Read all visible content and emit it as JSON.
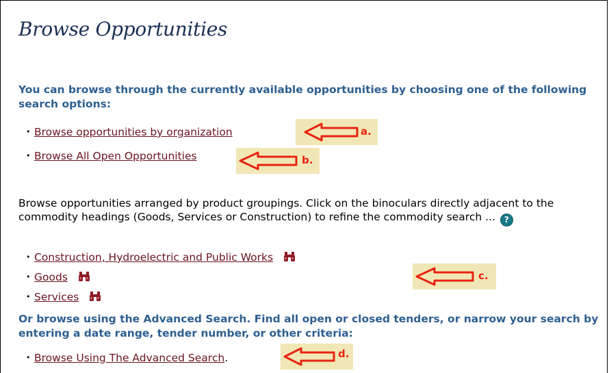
{
  "page": {
    "title": "Browse Opportunities",
    "intro_heading": "You can browse through the currently available opportunities by choosing one of the following search options:",
    "links": {
      "by_organization": "Browse opportunities by organization",
      "all_open": "Browse All Open Opportunities",
      "construction": "Construction, Hydroelectric and Public Works",
      "goods": "Goods",
      "services": "Services",
      "advanced": "Browse Using The Advanced Search"
    },
    "commodity_paragraph": "Browse opportunities arranged by product groupings. Click on the binoculars directly adjacent to the commodity headings (Goods, Services or Construction) to refine the commodity search ...",
    "help_glyph": "?",
    "advanced_heading": "Or browse using the Advanced Search. Find all open or closed tenders, or narrow your search by entering a date range, tender number, or other criteria:",
    "advanced_suffix": ".",
    "bullet": "•"
  },
  "annotations": {
    "a": "a.",
    "b": "b.",
    "c": "c.",
    "d": "d."
  },
  "colors": {
    "title": "#1a2f55",
    "heading": "#2d5f91",
    "link": "#6b1420",
    "callout_bg": "#f1e7b6",
    "callout_arrow": "#e82410",
    "binoculars": "#8e1b24"
  },
  "icons": {
    "binoculars": "binoculars-icon",
    "help": "help-icon",
    "arrow": "left-arrow-icon"
  }
}
